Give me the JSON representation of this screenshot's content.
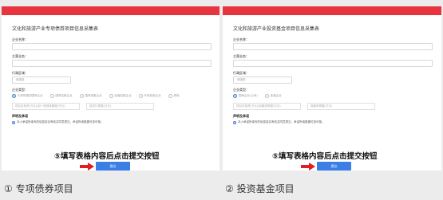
{
  "panels": [
    {
      "form_title": "文化和旅游产业专项债券项目信息采集表",
      "fields": [
        {
          "label": "企业名称：",
          "placeholder": ""
        },
        {
          "label": "主营业务：",
          "placeholder": ""
        },
        {
          "label": "行政区域：",
          "placeholder": "请选择"
        }
      ],
      "type_label": "企业类型：",
      "radio_options": [
        "中央所属的国有企业",
        "国有控股企业",
        "国有参股企业",
        "民营控股企业",
        "外商投资企业",
        "其他"
      ],
      "extra_inputs": [
        "项目总投资(万元)/拟一般债券额度(万元)",
        "拟发行规模(万元)"
      ],
      "declaration_title": "声明及承诺",
      "declaration_text": "本人承诺所填写的信息真实有效并同意提交，承诺所填数据可查可核。",
      "instruction": "⑤填写表格内容后点击提交按钮",
      "submit_label": "提交"
    },
    {
      "form_title": "文化和旅游产业投资基金项目信息采集表",
      "fields": [
        {
          "label": "企业名称：",
          "placeholder": ""
        },
        {
          "label": "主营业务：",
          "placeholder": ""
        },
        {
          "label": "行政区域：",
          "placeholder": "请选择"
        }
      ],
      "type_label": "企业类型：",
      "radio_options": [
        "国有企业(公司)",
        "民营企业"
      ],
      "extra_inputs": [
        "项目总投资(万元)/拟融资规模(万元)",
        "拟融资规模(万元)"
      ],
      "declaration_title": "声明及承诺",
      "declaration_text": "本人承诺所填写的信息真实有效并同意提交，承诺所填数据可查可核。",
      "instruction": "⑤填写表格内容后点击提交按钮",
      "submit_label": "提交"
    }
  ],
  "captions": [
    "① 专项债券项目",
    "② 投资基金项目"
  ],
  "colors": {
    "topbar": "#e8343f",
    "submit": "#3b7ee6",
    "arrow": "#e02020"
  }
}
